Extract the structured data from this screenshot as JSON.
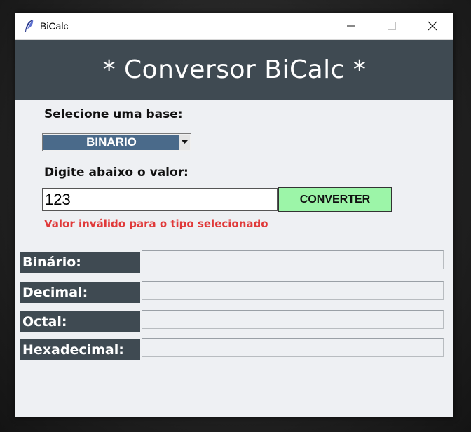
{
  "window": {
    "title": "BiCalc",
    "icon": "feather-icon"
  },
  "header": {
    "title": "* Conversor BiCalc *"
  },
  "form": {
    "base_label": "Selecione uma base:",
    "base_selected": "BINARIO",
    "value_label": "Digite abaixo o valor:",
    "value_input": "123",
    "convert_button": "CONVERTER",
    "error_message": "Valor inválido para o tipo selecionado"
  },
  "results": [
    {
      "label": "Binário:",
      "value": ""
    },
    {
      "label": "Decimal:",
      "value": ""
    },
    {
      "label": "Octal:",
      "value": ""
    },
    {
      "label": "Hexadecimal:",
      "value": ""
    }
  ],
  "colors": {
    "header_bg": "#3f4a52",
    "select_bg": "#4a6a8a",
    "convert_bg": "#9cf5a8",
    "error": "#e03a3a",
    "window_bg": "#eef0f3"
  }
}
